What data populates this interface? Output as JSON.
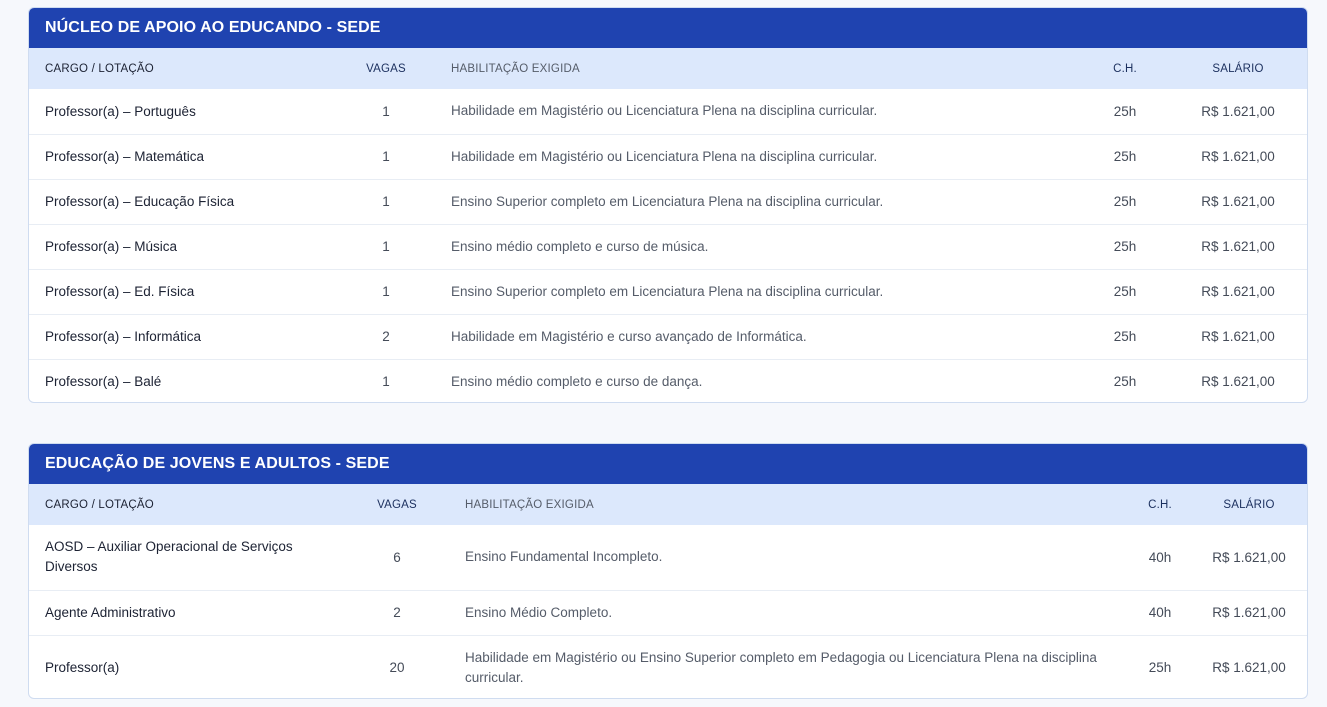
{
  "sections": [
    {
      "title": "NÚCLEO DE APOIO AO EDUCANDO - SEDE",
      "headers": {
        "cargo": "CARGO / LOTAÇÃO",
        "vagas": "VAGAS",
        "habilitacao": "HABILITAÇÃO EXIGIDA",
        "ch": "C.H.",
        "salario": "SALÁRIO"
      },
      "rows": [
        {
          "cargo": "Professor(a) – Português",
          "vagas": "1",
          "habilitacao": "Habilidade em Magistério ou Licenciatura Plena na disciplina curricular.",
          "ch": "25h",
          "salario": "R$ 1.621,00"
        },
        {
          "cargo": "Professor(a) – Matemática",
          "vagas": "1",
          "habilitacao": "Habilidade em Magistério ou Licenciatura Plena na disciplina curricular.",
          "ch": "25h",
          "salario": "R$ 1.621,00"
        },
        {
          "cargo": "Professor(a) – Educação Física",
          "vagas": "1",
          "habilitacao": "Ensino Superior completo em Licenciatura Plena na disciplina curricular.",
          "ch": "25h",
          "salario": "R$ 1.621,00"
        },
        {
          "cargo": "Professor(a) – Música",
          "vagas": "1",
          "habilitacao": "Ensino médio completo e curso de música.",
          "ch": "25h",
          "salario": "R$ 1.621,00"
        },
        {
          "cargo": "Professor(a) – Ed. Física",
          "vagas": "1",
          "habilitacao": "Ensino Superior completo em Licenciatura Plena na disciplina curricular.",
          "ch": "25h",
          "salario": "R$ 1.621,00"
        },
        {
          "cargo": "Professor(a) – Informática",
          "vagas": "2",
          "habilitacao": "Habilidade em Magistério e curso avançado de Informática.",
          "ch": "25h",
          "salario": "R$ 1.621,00"
        },
        {
          "cargo": "Professor(a) – Balé",
          "vagas": "1",
          "habilitacao": "Ensino médio completo e curso de dança.",
          "ch": "25h",
          "salario": "R$ 1.621,00"
        }
      ]
    },
    {
      "title": "EDUCAÇÃO DE JOVENS E ADULTOS - SEDE",
      "headers": {
        "cargo": "CARGO / LOTAÇÃO",
        "vagas": "VAGAS",
        "habilitacao": "HABILITAÇÃO EXIGIDA",
        "ch": "C.H.",
        "salario": "SALÁRIO"
      },
      "rows": [
        {
          "cargo_line1": "AOSD – Auxiliar Operacional de Serviços",
          "cargo_line2": "Diversos",
          "vagas": "6",
          "habilitacao": "Ensino Fundamental Incompleto.",
          "ch": "40h",
          "salario": "R$ 1.621,00"
        },
        {
          "cargo": "Agente Administrativo",
          "vagas": "2",
          "habilitacao": "Ensino Médio Completo.",
          "ch": "40h",
          "salario": "R$ 1.621,00"
        },
        {
          "cargo": "Professor(a)",
          "vagas": "20",
          "habilitacao_line1": "Habilidade em Magistério ou Ensino Superior completo em Pedagogia ou Licenciatura Plena na disciplina",
          "habilitacao_line2": "curricular.",
          "ch": "25h",
          "salario": "R$ 1.621,00"
        }
      ]
    }
  ],
  "colors": {
    "header_bar": "#1f43b0",
    "table_head": "#dce8fc",
    "page_background": "#f6f8fc"
  }
}
